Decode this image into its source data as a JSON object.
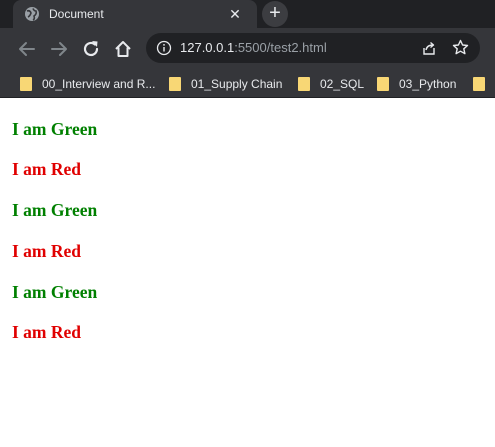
{
  "tab": {
    "title": "Document",
    "close_glyph": "✕",
    "favicon_icon": "globe-icon"
  },
  "new_tab": {
    "glyph": "+"
  },
  "address": {
    "host": "127.0.0.1",
    "path": ":5500/test2.html"
  },
  "bookmarks": [
    {
      "label": "00_Interview and R...",
      "icon": "folder-icon"
    },
    {
      "label": "01_Supply Chain",
      "icon": "folder-icon"
    },
    {
      "label": "02_SQL",
      "icon": "folder-icon"
    },
    {
      "label": "03_Python",
      "icon": "folder-icon"
    }
  ],
  "page": {
    "lines": [
      {
        "text": "I am Green",
        "color": "#008000"
      },
      {
        "text": "I am Red",
        "color": "#e00000"
      },
      {
        "text": "I am Green",
        "color": "#008000"
      },
      {
        "text": "I am Red",
        "color": "#e00000"
      },
      {
        "text": "I am Green",
        "color": "#008000"
      },
      {
        "text": "I am Red",
        "color": "#e00000"
      }
    ]
  },
  "colors": {
    "chrome_dark": "#202124",
    "chrome_toolbar": "#35363a",
    "folder": "#f8d775",
    "green_text": "#008000",
    "red_text": "#e00000"
  }
}
